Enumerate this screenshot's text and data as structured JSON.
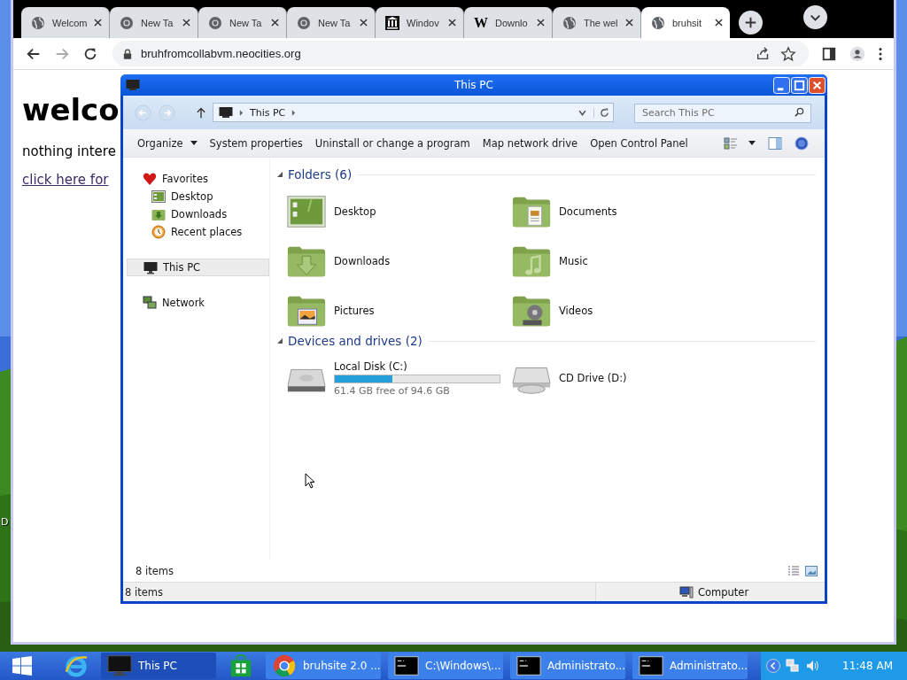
{
  "desktop": {
    "icon_label": "D"
  },
  "browser": {
    "tabs": [
      {
        "title": "Welcom",
        "kind": "globe",
        "selected": false
      },
      {
        "title": "New Ta",
        "kind": "chrome",
        "selected": false
      },
      {
        "title": "New Ta",
        "kind": "chrome",
        "selected": false
      },
      {
        "title": "New Ta",
        "kind": "chrome",
        "selected": false
      },
      {
        "title": "Windov",
        "kind": "columns",
        "selected": false
      },
      {
        "title": "Downlo",
        "kind": "letter",
        "favicon": "W",
        "selected": false
      },
      {
        "title": "The wel",
        "kind": "globe",
        "selected": false
      },
      {
        "title": "bruhsit",
        "kind": "globe",
        "selected": true
      }
    ],
    "address": "bruhfromcollabvm.neocities.org",
    "page": {
      "heading": "welco",
      "text": "nothing intere",
      "link": "click here for"
    }
  },
  "explorer": {
    "title": "This PC",
    "breadcrumb": "This PC",
    "search": {
      "placeholder": "Search This PC"
    },
    "commands": [
      {
        "label": "Organize",
        "dropdown": true
      },
      {
        "label": "System properties",
        "dropdown": false
      },
      {
        "label": "Uninstall or change a program",
        "dropdown": false
      },
      {
        "label": "Map network drive",
        "dropdown": false
      },
      {
        "label": "Open Control Panel",
        "dropdown": false
      }
    ],
    "nav": [
      {
        "label": "Favorites",
        "kind": "favorites",
        "selected": false,
        "children": [
          {
            "label": "Desktop",
            "kind": "desktop",
            "selected": false
          },
          {
            "label": "Downloads",
            "kind": "downloads",
            "selected": false
          },
          {
            "label": "Recent places",
            "kind": "recent",
            "selected": false
          }
        ]
      },
      {
        "label": "This PC",
        "kind": "pc",
        "selected": true
      },
      {
        "label": "Network",
        "kind": "network",
        "selected": false
      }
    ],
    "groups": [
      {
        "title": "Folders (6)",
        "items": [
          {
            "name": "Desktop",
            "kind": "desktop"
          },
          {
            "name": "Documents",
            "kind": "documents"
          },
          {
            "name": "Downloads",
            "kind": "downloads"
          },
          {
            "name": "Music",
            "kind": "music"
          },
          {
            "name": "Pictures",
            "kind": "pictures"
          },
          {
            "name": "Videos",
            "kind": "videos"
          }
        ]
      },
      {
        "title": "Devices and drives (2)",
        "items": [
          {
            "name": "Local Disk (C:)",
            "kind": "hdd",
            "level": 0.351,
            "detail": "61.4 GB free of 94.6 GB"
          },
          {
            "name": "CD Drive (D:)",
            "kind": "cd"
          }
        ]
      }
    ],
    "item_count": "8 items",
    "status": {
      "count": "8 items",
      "location": "Computer"
    }
  },
  "taskbar": {
    "items": [
      {
        "kind": "ie"
      },
      {
        "kind": "pc",
        "label": "This PC",
        "selected": true
      },
      {
        "kind": "store"
      },
      {
        "kind": "chrome",
        "label": "bruhsite 2.0 ...",
        "selected": false
      },
      {
        "kind": "cmd",
        "label": "C:\\Windows\\...",
        "selected": false
      },
      {
        "kind": "cmd",
        "label": "Administrato...",
        "selected": false
      },
      {
        "kind": "cmd",
        "label": "Administrato...",
        "selected": false
      }
    ],
    "clock": "11:48 AM"
  }
}
